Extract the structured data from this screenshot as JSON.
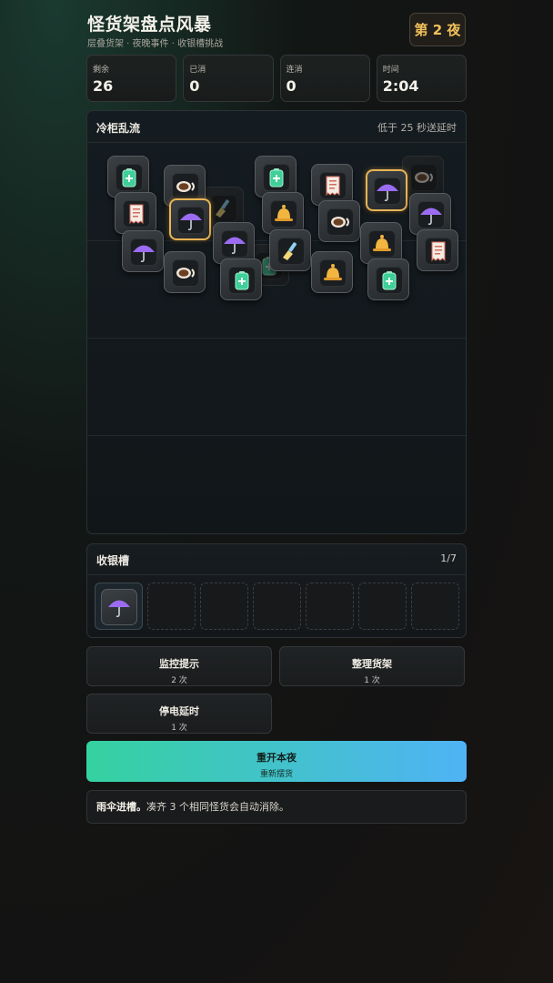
{
  "header": {
    "title": "怪货架盘点风暴",
    "subtitle": "层叠货架 · 夜晚事件 · 收银槽挑战",
    "night_badge": "第 2 夜"
  },
  "stats": [
    {
      "label": "剩余",
      "value": "26"
    },
    {
      "label": "已消",
      "value": "0"
    },
    {
      "label": "连消",
      "value": "0"
    },
    {
      "label": "时间",
      "value": "2:04"
    }
  ],
  "board": {
    "event_title": "冷柜乱流",
    "event_hint": "低于 25 秒送延时",
    "tiles": [
      {
        "icon": "coffee",
        "state": "dim"
      },
      {
        "icon": "broom",
        "state": "dim"
      },
      {
        "icon": "battery",
        "state": "dim"
      },
      {
        "icon": "battery",
        "state": "normal"
      },
      {
        "icon": "coffee",
        "state": "normal"
      },
      {
        "icon": "battery",
        "state": "normal"
      },
      {
        "icon": "receipt",
        "state": "normal"
      },
      {
        "icon": "umbrella",
        "state": "selected"
      },
      {
        "icon": "receipt",
        "state": "normal"
      },
      {
        "icon": "umbrella",
        "state": "selected"
      },
      {
        "icon": "bell",
        "state": "normal"
      },
      {
        "icon": "coffee",
        "state": "normal"
      },
      {
        "icon": "umbrella",
        "state": "normal"
      },
      {
        "icon": "umbrella",
        "state": "normal"
      },
      {
        "icon": "umbrella",
        "state": "normal"
      },
      {
        "icon": "broom",
        "state": "normal"
      },
      {
        "icon": "bell",
        "state": "normal"
      },
      {
        "icon": "receipt",
        "state": "normal"
      },
      {
        "icon": "coffee",
        "state": "normal"
      },
      {
        "icon": "battery",
        "state": "normal"
      },
      {
        "icon": "bell",
        "state": "normal"
      },
      {
        "icon": "battery",
        "state": "normal"
      }
    ]
  },
  "tray": {
    "title": "收银槽",
    "count": "1/7",
    "slots": [
      "umbrella",
      "",
      "",
      "",
      "",
      "",
      ""
    ]
  },
  "actions": {
    "hint": {
      "label": "监控提示",
      "sub": "2 次"
    },
    "shuffle": {
      "label": "整理货架",
      "sub": "1 次"
    },
    "freeze": {
      "label": "停电延时",
      "sub": "1 次"
    },
    "restart": {
      "label": "重开本夜",
      "sub": "重新摆货"
    }
  },
  "message": {
    "bold": "雨伞进槽。",
    "text": "凑齐 3 个相同怪货会自动消除。"
  },
  "colors": {
    "accent_gold": "#e8b455",
    "gradient_start": "#35d2a0",
    "gradient_end": "#4fb3f5"
  }
}
